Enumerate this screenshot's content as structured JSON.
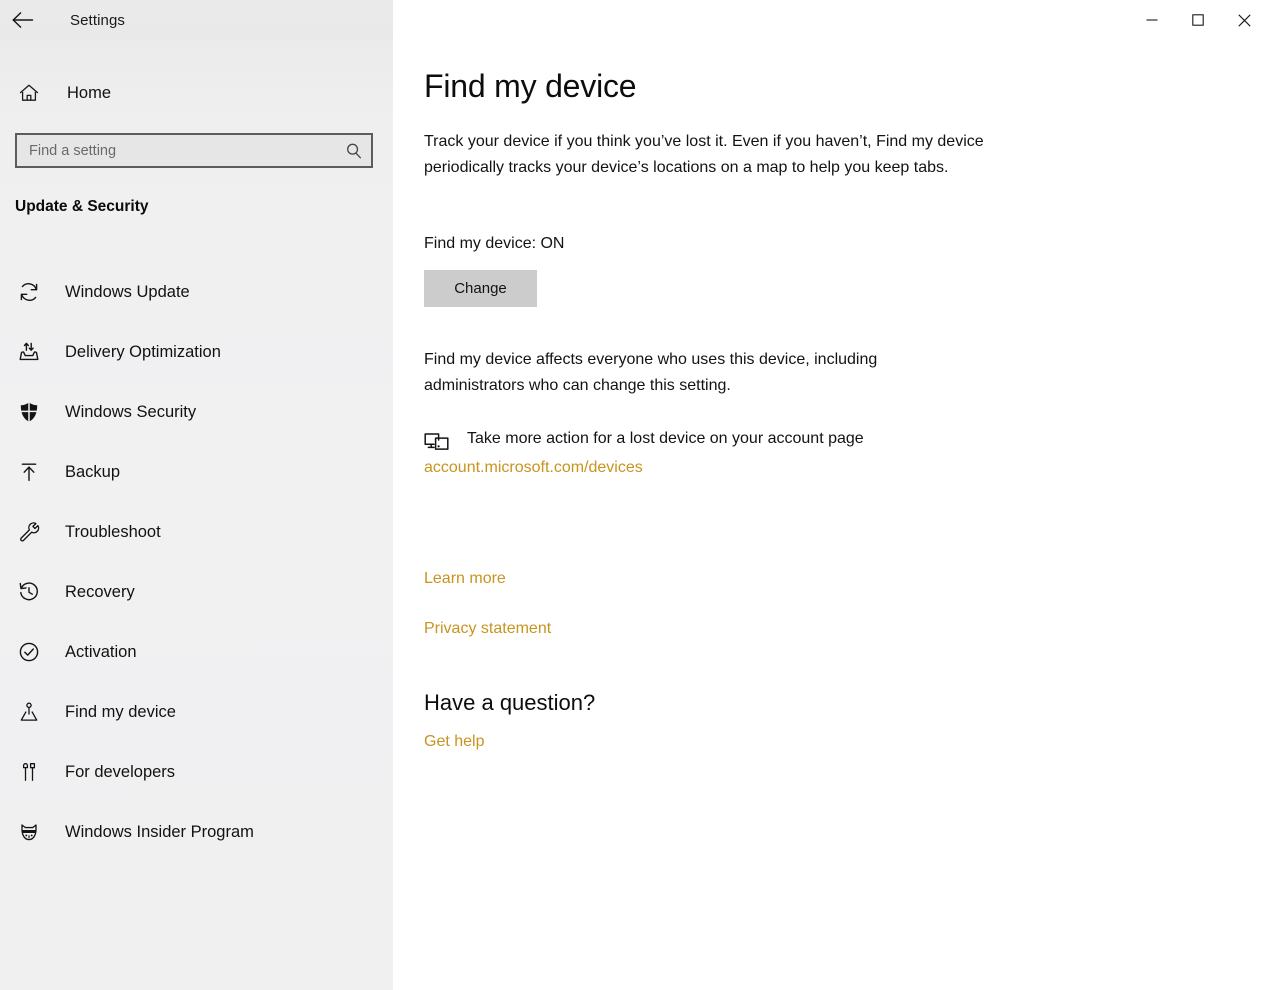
{
  "window": {
    "app_title": "Settings",
    "back_icon": "back-arrow-icon",
    "controls": {
      "minimize": "minimize-icon",
      "maximize": "maximize-icon",
      "close": "close-icon"
    }
  },
  "sidebar": {
    "home": {
      "label": "Home",
      "icon": "home-icon"
    },
    "search": {
      "placeholder": "Find a setting",
      "value": "",
      "icon": "search-icon"
    },
    "group_title": "Update & Security",
    "items": [
      {
        "label": "Windows Update",
        "icon": "sync-icon"
      },
      {
        "label": "Delivery Optimization",
        "icon": "delivery-optimization-icon"
      },
      {
        "label": "Windows Security",
        "icon": "shield-icon"
      },
      {
        "label": "Backup",
        "icon": "backup-upload-icon"
      },
      {
        "label": "Troubleshoot",
        "icon": "wrench-icon"
      },
      {
        "label": "Recovery",
        "icon": "history-clock-icon"
      },
      {
        "label": "Activation",
        "icon": "check-circle-icon"
      },
      {
        "label": "Find my device",
        "icon": "find-my-device-icon"
      },
      {
        "label": "For developers",
        "icon": "developer-tools-icon"
      },
      {
        "label": "Windows Insider Program",
        "icon": "ninjacat-icon"
      }
    ]
  },
  "main": {
    "title": "Find my device",
    "intro": "Track your device if you think you’ve lost it. Even if you haven’t, Find my device periodically tracks your device’s locations on a map to help you keep tabs.",
    "status_label": "Find my device: ON",
    "change_button": "Change",
    "affects_text": "Find my device affects everyone who uses this device, including administrators who can change this setting.",
    "account": {
      "icon": "devices-icon",
      "text": "Take more action for a lost device on your account page",
      "url": "account.microsoft.com/devices"
    },
    "learn_more": "Learn more",
    "privacy_statement": "Privacy statement",
    "question_heading": "Have a question?",
    "get_help": "Get help"
  },
  "colors": {
    "link": "#c8941f",
    "sidebar_bg": "#f0f0f1",
    "button_bg": "#cccccc",
    "text": "#131313"
  }
}
